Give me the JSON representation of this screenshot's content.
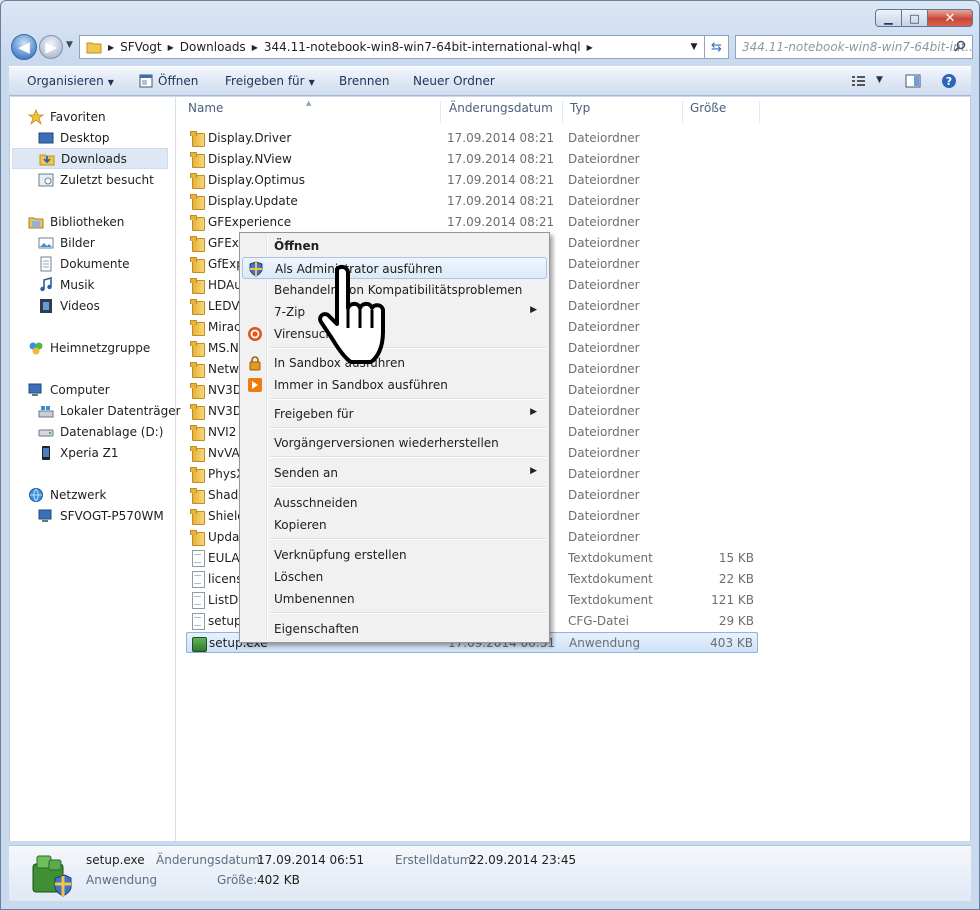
{
  "window": {
    "caption": {
      "minimize": "▁",
      "maximize": "□",
      "close": "✕"
    }
  },
  "address": {
    "crumbs": [
      "SFVogt",
      "Downloads",
      "344.11-notebook-win8-win7-64bit-international-whql"
    ],
    "search_placeholder": "344.11-notebook-win8-win7-64bit-int..."
  },
  "toolbar": {
    "organize": "Organisieren",
    "open": "Öffnen",
    "share": "Freigeben für",
    "burn": "Brennen",
    "new_folder": "Neuer Ordner"
  },
  "navpane": {
    "favorites": "Favoriten",
    "desktop": "Desktop",
    "downloads": "Downloads",
    "recent": "Zuletzt besucht",
    "libraries": "Bibliotheken",
    "pictures": "Bilder",
    "documents": "Dokumente",
    "music": "Musik",
    "videos": "Videos",
    "homegroup": "Heimnetzgruppe",
    "computer": "Computer",
    "local_disk": "Lokaler Datenträger",
    "data_disk": "Datenablage (D:)",
    "phone": "Xperia Z1",
    "network": "Netzwerk",
    "network_pc": "SFVOGT-P570WM"
  },
  "columns": {
    "name": "Name",
    "date": "Änderungsdatum",
    "type": "Typ",
    "size": "Größe"
  },
  "files": [
    {
      "name": "Display.Driver",
      "date": "17.09.2014 08:21",
      "type": "Dateiordner",
      "size": "",
      "kind": "folder"
    },
    {
      "name": "Display.NView",
      "date": "17.09.2014 08:21",
      "type": "Dateiordner",
      "size": "",
      "kind": "folder"
    },
    {
      "name": "Display.Optimus",
      "date": "17.09.2014 08:21",
      "type": "Dateiordner",
      "size": "",
      "kind": "folder"
    },
    {
      "name": "Display.Update",
      "date": "17.09.2014 08:21",
      "type": "Dateiordner",
      "size": "",
      "kind": "folder"
    },
    {
      "name": "GFExperience",
      "date": "17.09.2014 08:21",
      "type": "Dateiordner",
      "size": "",
      "kind": "folder"
    },
    {
      "name": "GFExp",
      "date": "",
      "type": "Dateiordner",
      "size": "",
      "kind": "folder"
    },
    {
      "name": "GfExpe",
      "date": "",
      "type": "Dateiordner",
      "size": "",
      "kind": "folder"
    },
    {
      "name": "HDAu",
      "date": "",
      "type": "Dateiordner",
      "size": "",
      "kind": "folder"
    },
    {
      "name": "LEDVis",
      "date": "",
      "type": "Dateiordner",
      "size": "",
      "kind": "folder"
    },
    {
      "name": "Miraca",
      "date": "",
      "type": "Dateiordner",
      "size": "",
      "kind": "folder"
    },
    {
      "name": "MS.NE",
      "date": "",
      "type": "Dateiordner",
      "size": "",
      "kind": "folder"
    },
    {
      "name": "Netwo",
      "date": "",
      "type": "Dateiordner",
      "size": "",
      "kind": "folder"
    },
    {
      "name": "NV3DV",
      "date": "",
      "type": "Dateiordner",
      "size": "",
      "kind": "folder"
    },
    {
      "name": "NV3DV",
      "date": "",
      "type": "Dateiordner",
      "size": "",
      "kind": "folder"
    },
    {
      "name": "NVI2",
      "date": "",
      "type": "Dateiordner",
      "size": "",
      "kind": "folder"
    },
    {
      "name": "NvVAI",
      "date": "",
      "type": "Dateiordner",
      "size": "",
      "kind": "folder"
    },
    {
      "name": "PhysX",
      "date": "",
      "type": "Dateiordner",
      "size": "",
      "kind": "folder"
    },
    {
      "name": "Shado",
      "date": "",
      "type": "Dateiordner",
      "size": "",
      "kind": "folder"
    },
    {
      "name": "Shield",
      "date": "",
      "type": "Dateiordner",
      "size": "",
      "kind": "folder"
    },
    {
      "name": "Updat",
      "date": "",
      "type": "Dateiordner",
      "size": "",
      "kind": "folder"
    },
    {
      "name": "EULA.",
      "date": "",
      "type": "Textdokument",
      "size": "15 KB",
      "kind": "doc"
    },
    {
      "name": "licens",
      "date": "",
      "type": "Textdokument",
      "size": "22 KB",
      "kind": "doc"
    },
    {
      "name": "ListDe",
      "date": "",
      "type": "Textdokument",
      "size": "121 KB",
      "kind": "doc"
    },
    {
      "name": "setup.",
      "date": "",
      "type": "CFG-Datei",
      "size": "29 KB",
      "kind": "doc"
    },
    {
      "name": "setup.exe",
      "date": "17.09.2014 06:51",
      "type": "Anwendung",
      "size": "403 KB",
      "kind": "exe"
    }
  ],
  "context_menu": {
    "open": "Öffnen",
    "run_as_admin": "Als Administrator ausführen",
    "compat": "Behandeln von Kompatibilitätsproblemen",
    "zip": "7-Zip",
    "virus": "Virensuche",
    "sandbox": "In Sandbox ausführen",
    "sandbox_always": "Immer in Sandbox ausführen",
    "share": "Freigeben für",
    "prev_versions": "Vorgängerversionen wiederherstellen",
    "send_to": "Senden an",
    "cut": "Ausschneiden",
    "copy": "Kopieren",
    "shortcut": "Verknüpfung erstellen",
    "delete": "Löschen",
    "rename": "Umbenennen",
    "properties": "Eigenschaften"
  },
  "details": {
    "name": "setup.exe",
    "kind": "Anwendung",
    "modified_label": "Änderungsdatum:",
    "modified": "17.09.2014 06:51",
    "created_label": "Erstelldatum:",
    "created": "22.09.2014 23:45",
    "size_label": "Größe:",
    "size": "402 KB"
  }
}
